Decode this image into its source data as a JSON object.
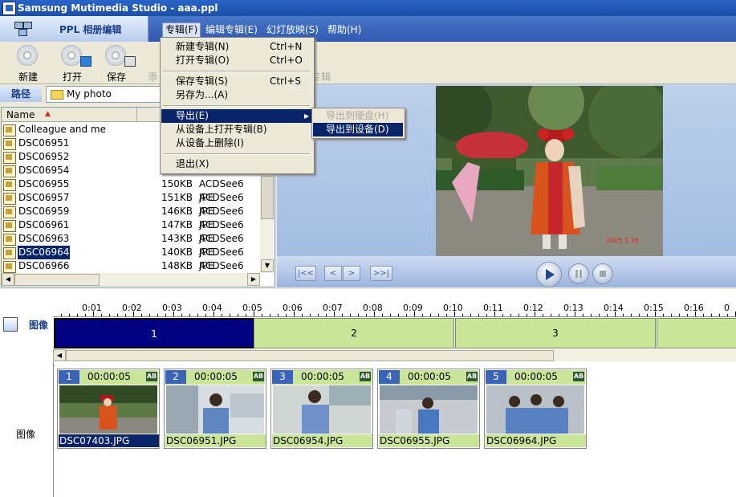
{
  "window": {
    "title": "Samsung Mutimedia Studio - aaa.ppl"
  },
  "ppl_tab": {
    "label": "PPL 相册编辑"
  },
  "menubar": [
    "专辑(F)",
    "编辑专辑(E)",
    "幻灯放映(S)",
    "帮助(H)"
  ],
  "toolbar": {
    "new": "新建",
    "open": "打开",
    "save": "保存",
    "add_partial": "添",
    "album_partial": "专辑"
  },
  "path": {
    "label": "路径",
    "value": "My photo"
  },
  "filelist": {
    "header_name": "Name",
    "sort_indicator": "▲",
    "rows": [
      {
        "name": "Colleague and me",
        "size": "",
        "type": ""
      },
      {
        "name": "DSC06951",
        "size": "",
        "type": ""
      },
      {
        "name": "DSC06952",
        "size": "",
        "type": ""
      },
      {
        "name": "DSC06954",
        "size": "",
        "type": ""
      },
      {
        "name": "DSC06955",
        "size": "150KB",
        "type": "ACDSee6 JPE"
      },
      {
        "name": "DSC06957",
        "size": "151KB",
        "type": "ACDSee6 JPE"
      },
      {
        "name": "DSC06959",
        "size": "146KB",
        "type": "ACDSee6 JPE"
      },
      {
        "name": "DSC06961",
        "size": "147KB",
        "type": "ACDSee6 JPE"
      },
      {
        "name": "DSC06963",
        "size": "143KB",
        "type": "ACDSee6 JPE"
      },
      {
        "name": "DSC06964",
        "size": "140KB",
        "type": "ACDSee6 JPE"
      },
      {
        "name": "DSC06966",
        "size": "148KB",
        "type": "ACDSee6 JPE"
      }
    ]
  },
  "preview": {
    "date_stamp": "2005 1 16"
  },
  "player": {
    "first": "|<<",
    "prev": "<",
    "next": ">",
    "last": ">>|"
  },
  "timeline": {
    "ticks": [
      "0:01",
      "0:02",
      "0:03",
      "0:04",
      "0:05",
      "0:06",
      "0:07",
      "0:08",
      "0:09",
      "0:10",
      "0:11",
      "0:12",
      "0:13",
      "0:14",
      "0:15",
      "0:16",
      "0"
    ],
    "track_label": "图像",
    "segments": [
      "1",
      "2",
      "3"
    ]
  },
  "storyboard": {
    "label": "图像",
    "badge": "AB",
    "cards": [
      {
        "num": "1",
        "time": "00:00:05",
        "file": "DSC07403.JPG"
      },
      {
        "num": "2",
        "time": "00:00:05",
        "file": "DSC06951.JPG"
      },
      {
        "num": "3",
        "time": "00:00:05",
        "file": "DSC06954.JPG"
      },
      {
        "num": "4",
        "time": "00:00:05",
        "file": "DSC06955.JPG"
      },
      {
        "num": "5",
        "time": "00:00:05",
        "file": "DSC06964.JPG"
      }
    ]
  },
  "menu_album": {
    "items": [
      {
        "label": "新建专辑(N)",
        "shortcut": "Ctrl+N"
      },
      {
        "label": "打开专辑(O)",
        "shortcut": "Ctrl+O"
      },
      {
        "label": "保存专辑(S)",
        "shortcut": "Ctrl+S"
      },
      {
        "label": "另存为...(A)",
        "shortcut": ""
      },
      {
        "label": "导出(E)",
        "shortcut": ""
      },
      {
        "label": "从设备上打开专辑(B)",
        "shortcut": ""
      },
      {
        "label": "从设备上删除(I)",
        "shortcut": ""
      },
      {
        "label": "退出(X)",
        "shortcut": ""
      }
    ]
  },
  "menu_export": {
    "items": [
      {
        "label": "导出到硬盘(H)"
      },
      {
        "label": "导出到设备(D)"
      }
    ]
  }
}
